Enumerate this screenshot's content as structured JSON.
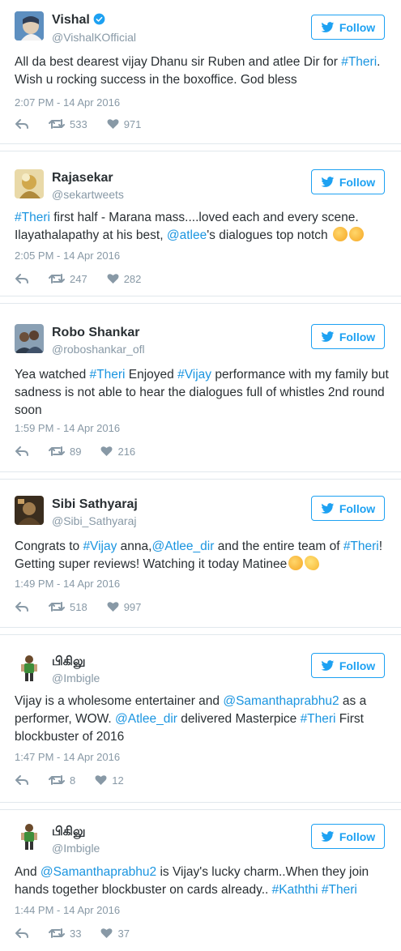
{
  "follow_label": "Follow",
  "tweets": [
    {
      "name": "Vishal",
      "handle": "@VishalKOfficial",
      "verified": true,
      "text_parts": [
        "All da best dearest vijay Dhanu sir Ruben and atlee Dir for ",
        "#Theri",
        ". Wish u rocking success in the boxoffice. God bless"
      ],
      "time": "2:07 PM - 14 Apr 2016",
      "retweets": "533",
      "likes": "971"
    },
    {
      "name": "Rajasekar",
      "handle": "@sekartweets",
      "text_parts": [
        "#Theri",
        " first half - Marana mass....loved each and every scene. Ilayathalapathy at his best, ",
        "@atlee",
        "'s dialogues top notch"
      ],
      "time": "2:05 PM - 14 Apr 2016",
      "retweets": "247",
      "likes": "282"
    },
    {
      "name": "Robo Shankar",
      "handle": "@roboshankar_ofl",
      "text_parts": [
        "Yea watched ",
        "#Theri",
        " Enjoyed ",
        "#Vijay",
        " performance with my family but sadness is not able to hear the dialogues full of whistles 2nd round soon"
      ],
      "time": "1:59 PM - 14 Apr 2016",
      "retweets": "89",
      "likes": "216"
    },
    {
      "name": "Sibi Sathyaraj",
      "handle": "@Sibi_Sathyaraj",
      "text_parts": [
        "Congrats to ",
        "#Vijay",
        " anna,",
        "@Atlee_dir",
        " and the entire team of ",
        "#Theri",
        "! Getting super reviews! Watching it today Matinee"
      ],
      "time": "1:49 PM - 14 Apr 2016",
      "retweets": "518",
      "likes": "997"
    },
    {
      "name": "பிகிலு",
      "handle": "@Imbigle",
      "text_parts": [
        "Vijay is a wholesome entertainer and ",
        "@Samanthaprabhu2",
        " as a performer, WOW. ",
        "@Atlee_dir",
        " delivered Masterpice ",
        "#Theri",
        " First blockbuster of 2016"
      ],
      "time": "1:47 PM - 14 Apr 2016",
      "retweets": "8",
      "likes": "12"
    },
    {
      "name": "பிகிலு",
      "handle": "@Imbigle",
      "text_parts": [
        "And ",
        "@Samanthaprabhu2",
        " is Vijay's lucky charm..When they join hands together blockbuster on cards already.. ",
        "#Kaththi",
        " ",
        "#Theri"
      ],
      "time": "1:44 PM - 14 Apr 2016",
      "retweets": "33",
      "likes": "37"
    }
  ],
  "colors": {
    "accent": "#1da1f2",
    "link": "#1b95e0",
    "meta": "#8899a6",
    "text": "#292f33"
  }
}
